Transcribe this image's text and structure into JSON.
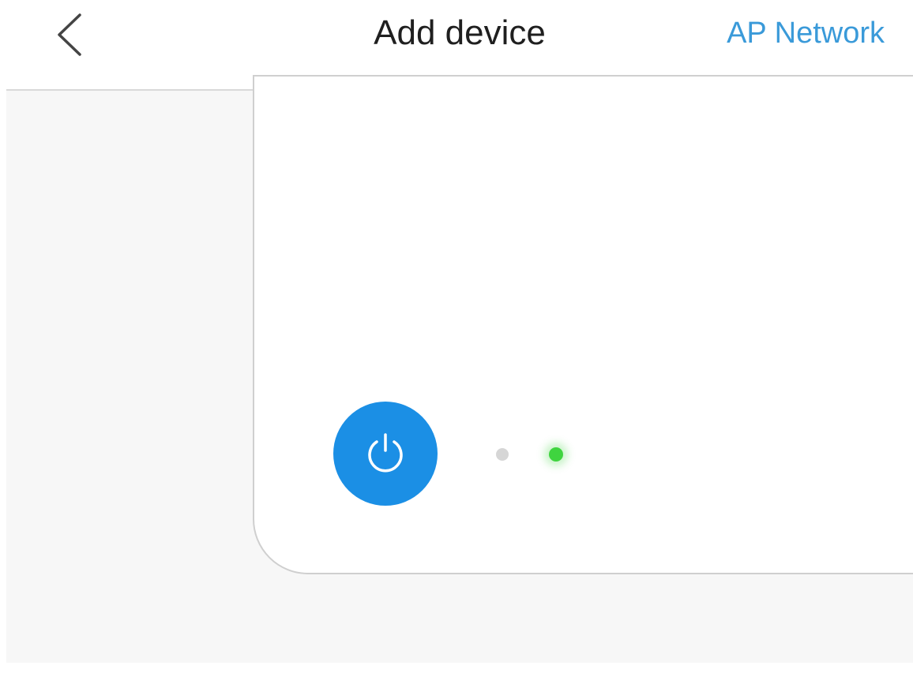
{
  "header": {
    "title": "Add device",
    "right_link": "AP Network",
    "back_icon": "chevron-left-icon"
  },
  "device_illustration": {
    "power_icon": "power-icon",
    "indicators": [
      {
        "state": "off",
        "color": "#d6d6d6"
      },
      {
        "state": "on",
        "color": "#3fd43f"
      }
    ]
  },
  "colors": {
    "accent": "#1b8fe5",
    "link": "#3a9ad9",
    "indicator_on": "#3fd43f",
    "indicator_off": "#d6d6d6"
  }
}
